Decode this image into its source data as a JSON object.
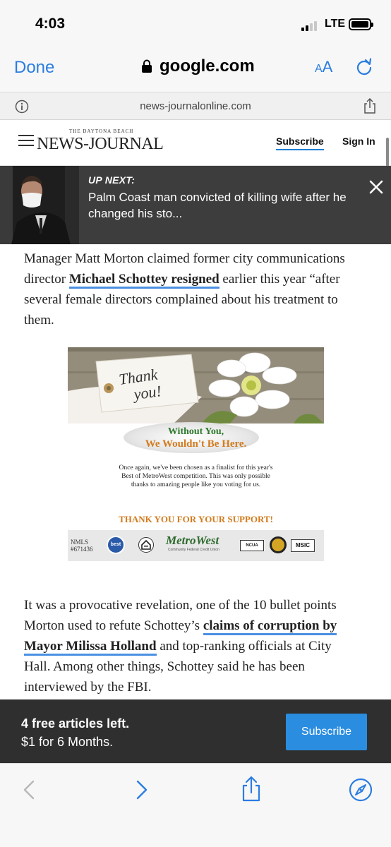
{
  "status": {
    "time": "4:03",
    "network": "LTE",
    "signal_bars": 2,
    "signal_bars_total": 4
  },
  "browser": {
    "done_label": "Done",
    "domain": "google.com",
    "text_size_label": "A",
    "text_size_label_large": "A",
    "page_url": "news-journalonline.com"
  },
  "site": {
    "logo_small": "THE DAYTONA BEACH",
    "logo_main": "NEWS-JOURNAL",
    "subscribe_label": "Subscribe",
    "signin_label": "Sign In"
  },
  "up_next": {
    "label": "UP NEXT:",
    "title": "Palm Coast man convicted of killing wife after he changed his sto..."
  },
  "article": {
    "p1_before": "Manager Matt Morton claimed former city communications director ",
    "p1_link": "Michael Schottey resigned",
    "p1_after": " earlier this year “after several female directors complained about his treatment to them.",
    "p2_before": "It was a provocative revelation, one of the 10 bullet points Morton used to refute Schottey’s ",
    "p2_link": "claims of corruption by Mayor Milissa Holland",
    "p2_after": " and top-ranking officials at City Hall. Among other things, Schottey said he has been interviewed by the FBI."
  },
  "ad": {
    "tag_line1": "Thank",
    "tag_line2": "you!",
    "oval_line1": "Without You,",
    "oval_line2": "We Wouldn't Be Here.",
    "body_line1": "Once again, we've been chosen as a finalist for this year's",
    "body_line2": "Best of MetroWest competition. This was only possible",
    "body_line3": "thanks to amazing people like you voting for us.",
    "support": "THANK YOU FOR YOUR SUPPORT!",
    "nmls_line1": "NMLS",
    "nmls_line2": "#671436",
    "badge_best": "best",
    "brand": "MetroWest",
    "brand_sub": "Community Federal Credit Union",
    "ncua": "NCUA",
    "msic": "MSIC",
    "colors": {
      "green": "#2d7a2d",
      "orange": "#d27b1e"
    }
  },
  "paywall": {
    "line1": "4 free articles left.",
    "line2": "$1 for 6 Months.",
    "button": "Subscribe"
  },
  "toolbar": {
    "icons": [
      "back-arrow-icon",
      "forward-arrow-icon",
      "share-icon",
      "safari-compass-icon"
    ]
  },
  "colors": {
    "accent_blue": "#2b7de1",
    "link_underline": "#4a90e2",
    "subscribe_button": "#2a8de0",
    "paywall_bg": "#2f2f2f",
    "up_next_bg": "#3d3d3d"
  }
}
